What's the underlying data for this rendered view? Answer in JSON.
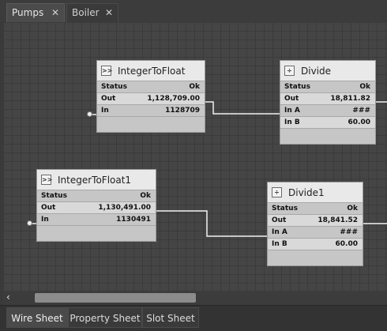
{
  "tabs": [
    {
      "label": "Pumps",
      "active": true,
      "close_icon": "close-icon"
    },
    {
      "label": "Boiler",
      "active": false,
      "close_icon": "close-icon"
    }
  ],
  "nodes": {
    "itf": {
      "title": "IntegerToFloat",
      "icon_text": ">>",
      "status_label": "Status",
      "status_value": "Ok",
      "out_label": "Out",
      "out_value": "1,128,709.00",
      "in_label": "In",
      "in_value": "1128709"
    },
    "divide": {
      "title": "Divide",
      "icon_text": "÷",
      "status_label": "Status",
      "status_value": "Ok",
      "out_label": "Out",
      "out_value": "18,811.82",
      "ina_label": "In A",
      "ina_value": "###",
      "inb_label": "In B",
      "inb_value": "60.00"
    },
    "itf1": {
      "title": "IntegerToFloat1",
      "icon_text": ">>",
      "status_label": "Status",
      "status_value": "Ok",
      "out_label": "Out",
      "out_value": "1,130,491.00",
      "in_label": "In",
      "in_value": "1130491"
    },
    "divide1": {
      "title": "Divide1",
      "icon_text": "÷",
      "status_label": "Status",
      "status_value": "Ok",
      "out_label": "Out",
      "out_value": "18,841.52",
      "ina_label": "In A",
      "ina_value": "###",
      "inb_label": "In B",
      "inb_value": "60.00"
    }
  },
  "scrollbar": {
    "left_arrow": "‹"
  },
  "bottom_tabs": [
    {
      "label": "Wire Sheet",
      "active": true
    },
    {
      "label": "Property Sheet",
      "active": false
    },
    {
      "label": "Slot Sheet",
      "active": false
    }
  ],
  "close_glyph": "✕"
}
